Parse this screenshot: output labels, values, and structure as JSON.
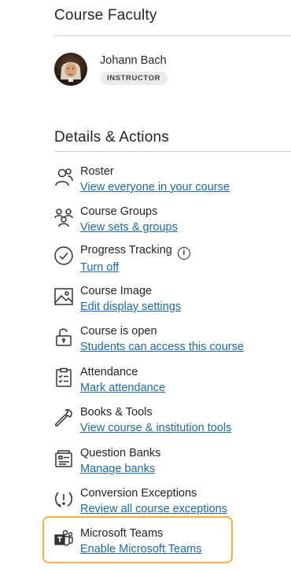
{
  "faculty": {
    "title": "Course Faculty",
    "members": [
      {
        "name": "Johann Bach",
        "role": "INSTRUCTOR"
      }
    ]
  },
  "details": {
    "title": "Details & Actions",
    "items": [
      {
        "icon": "roster-icon",
        "label": "Roster",
        "link": "View everyone in your course"
      },
      {
        "icon": "groups-icon",
        "label": "Course Groups",
        "link": "View sets & groups"
      },
      {
        "icon": "checkmark-circle-icon",
        "label": "Progress Tracking",
        "link": "Turn off",
        "info_icon": "info-icon"
      },
      {
        "icon": "image-icon",
        "label": "Course Image",
        "link": "Edit display settings"
      },
      {
        "icon": "unlock-icon",
        "label": "Course is open",
        "link": "Students can access this course"
      },
      {
        "icon": "clipboard-checklist-icon",
        "label": "Attendance",
        "link": "Mark attendance"
      },
      {
        "icon": "wrench-icon",
        "label": "Books & Tools",
        "link": "View course & institution tools"
      },
      {
        "icon": "question-bank-icon",
        "label": "Question Banks",
        "link": "Manage banks"
      },
      {
        "icon": "conversion-exceptions-icon",
        "label": "Conversion Exceptions",
        "link": "Review all course exceptions"
      },
      {
        "icon": "microsoft-teams-icon",
        "label": "Microsoft Teams",
        "link": "Enable Microsoft Teams"
      }
    ]
  },
  "colors": {
    "link": "#1f6aa6",
    "highlight": "#f3b13d",
    "divider": "#cdcdcd"
  }
}
